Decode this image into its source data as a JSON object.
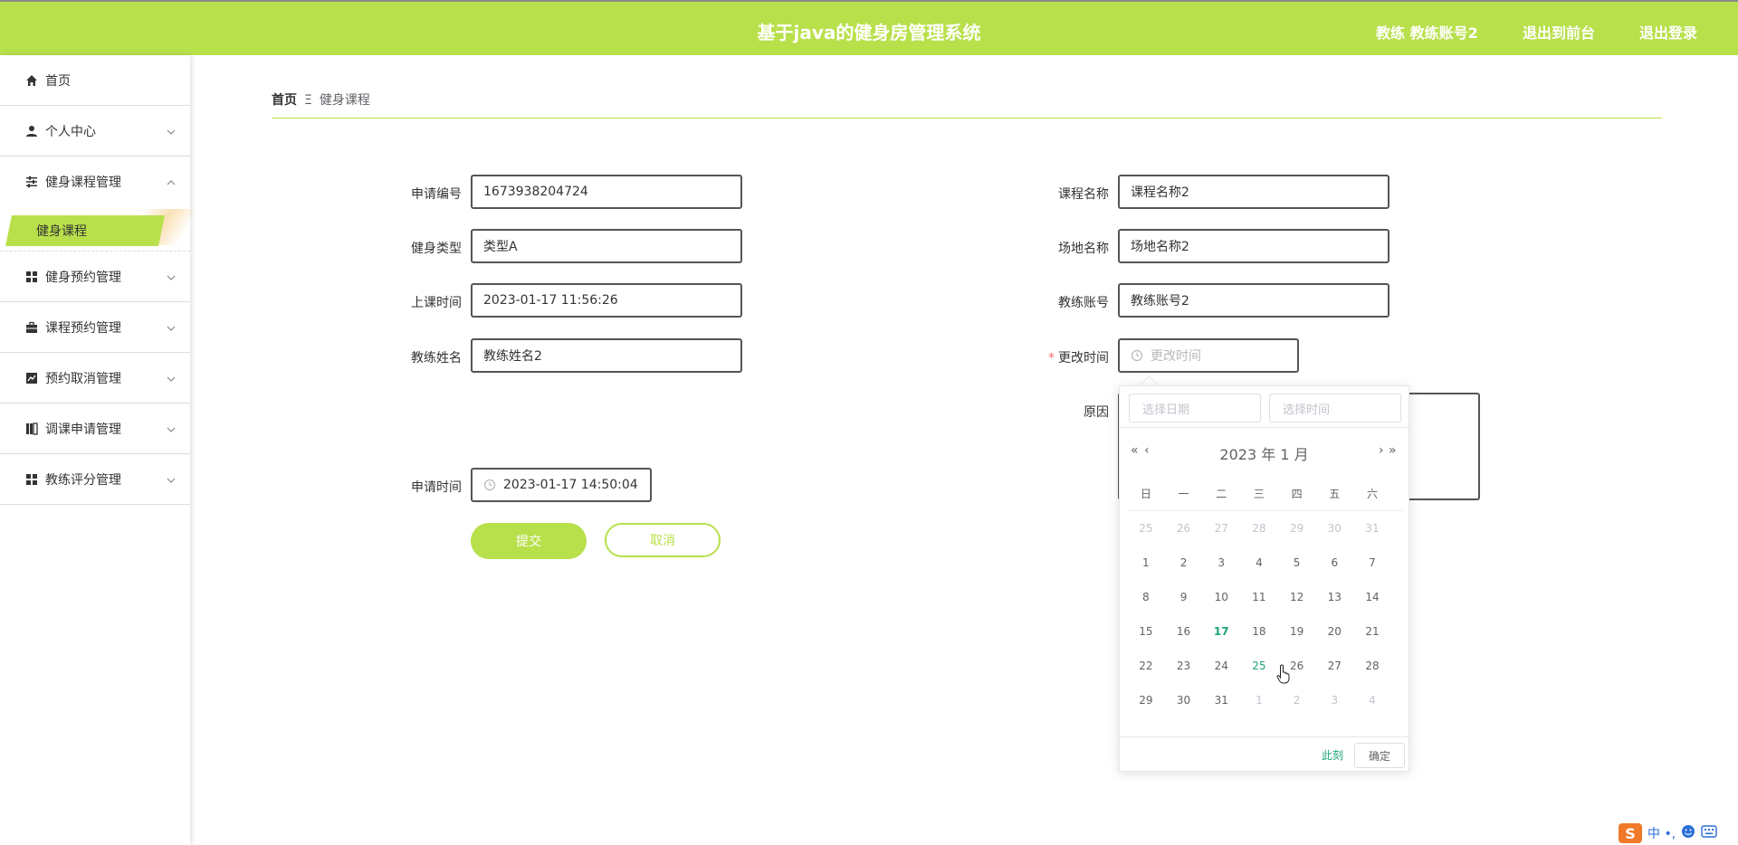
{
  "header": {
    "title": "基于java的健身房管理系统",
    "user_label": "教练 教练账号2",
    "front_label": "退出到前台",
    "logout_label": "退出登录"
  },
  "sidebar": {
    "items": [
      {
        "label": "首页",
        "icon": "home-icon"
      },
      {
        "label": "个人中心",
        "icon": "user-icon"
      },
      {
        "label": "健身课程管理",
        "icon": "sliders-icon"
      },
      {
        "label": "健身预约管理",
        "icon": "grid-icon"
      },
      {
        "label": "课程预约管理",
        "icon": "briefcase-icon"
      },
      {
        "label": "预约取消管理",
        "icon": "chart-icon"
      },
      {
        "label": "调课申请管理",
        "icon": "book-icon"
      },
      {
        "label": "教练评分管理",
        "icon": "grid-icon"
      }
    ],
    "active_sub": "健身课程"
  },
  "breadcrumb": {
    "home": "首页",
    "separator": "Ξ",
    "current": "健身课程"
  },
  "form": {
    "apply_no_label": "申请编号",
    "apply_no_value": "1673938204724",
    "fitness_type_label": "健身类型",
    "fitness_type_value": "类型A",
    "class_time_label": "上课时间",
    "class_time_value": "2023-01-17 11:56:26",
    "coach_name_label": "教练姓名",
    "coach_name_value": "教练姓名2",
    "apply_time_label": "申请时间",
    "apply_time_value": "2023-01-17 14:50:04",
    "course_name_label": "课程名称",
    "course_name_value": "课程名称2",
    "venue_label": "场地名称",
    "venue_value": "场地名称2",
    "coach_account_label": "教练账号",
    "coach_account_value": "教练账号2",
    "change_time_required": "*",
    "change_time_label": "更改时间",
    "change_time_placeholder": "更改时间",
    "reason_label": "原因",
    "submit_label": "提交",
    "cancel_label": "取消"
  },
  "datepicker": {
    "date_placeholder": "选择日期",
    "time_placeholder": "选择时间",
    "year_nav_prev": "«",
    "month_nav_prev": "‹",
    "month_nav_next": "›",
    "year_nav_next": "»",
    "title": "2023 年  1 月",
    "weekdays": [
      "日",
      "一",
      "二",
      "三",
      "四",
      "五",
      "六"
    ],
    "weeks": [
      [
        "25",
        "26",
        "27",
        "28",
        "29",
        "30",
        "31"
      ],
      [
        "1",
        "2",
        "3",
        "4",
        "5",
        "6",
        "7"
      ],
      [
        "8",
        "9",
        "10",
        "11",
        "12",
        "13",
        "14"
      ],
      [
        "15",
        "16",
        "17",
        "18",
        "19",
        "20",
        "21"
      ],
      [
        "22",
        "23",
        "24",
        "25",
        "26",
        "27",
        "28"
      ],
      [
        "29",
        "30",
        "31",
        "1",
        "2",
        "3",
        "4"
      ]
    ],
    "today": "17",
    "hovered": "25",
    "now_label": "此刻",
    "ok_label": "确定"
  },
  "tray": {
    "ime_text": "中 •,"
  },
  "colors": {
    "accent": "#b8e04b",
    "today": "#1fa37a",
    "required": "#f56c6c"
  }
}
